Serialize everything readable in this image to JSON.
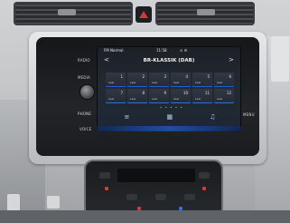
{
  "screen": {
    "status": {
      "left": "FM Normal",
      "time": "11:58",
      "right": "⊙ ☰"
    },
    "station": "BR-KLASSIK (DAB)",
    "presets": [
      {
        "num": "1",
        "label": "Leer"
      },
      {
        "num": "2",
        "label": "Leer"
      },
      {
        "num": "3",
        "label": "Leer"
      },
      {
        "num": "4",
        "label": "Leer"
      },
      {
        "num": "5",
        "label": "Leer"
      },
      {
        "num": "6",
        "label": "Leer"
      },
      {
        "num": "7",
        "label": "Leer"
      },
      {
        "num": "8",
        "label": "Leer"
      },
      {
        "num": "9",
        "label": "Leer"
      },
      {
        "num": "10",
        "label": "Leer"
      },
      {
        "num": "11",
        "label": "Leer"
      },
      {
        "num": "12",
        "label": "Leer"
      }
    ],
    "page_dots": "• • • • •",
    "bottom_icons": [
      "≡",
      "▦",
      "♫"
    ]
  },
  "bezel_buttons": {
    "radio": "RADIO",
    "media": "MEDIA",
    "phone": "PHONE",
    "voice": "VOICE",
    "menu": "MENU"
  },
  "colors": {
    "accent_blue": "#1f5fd6",
    "hazard_red": "#d8343a"
  }
}
